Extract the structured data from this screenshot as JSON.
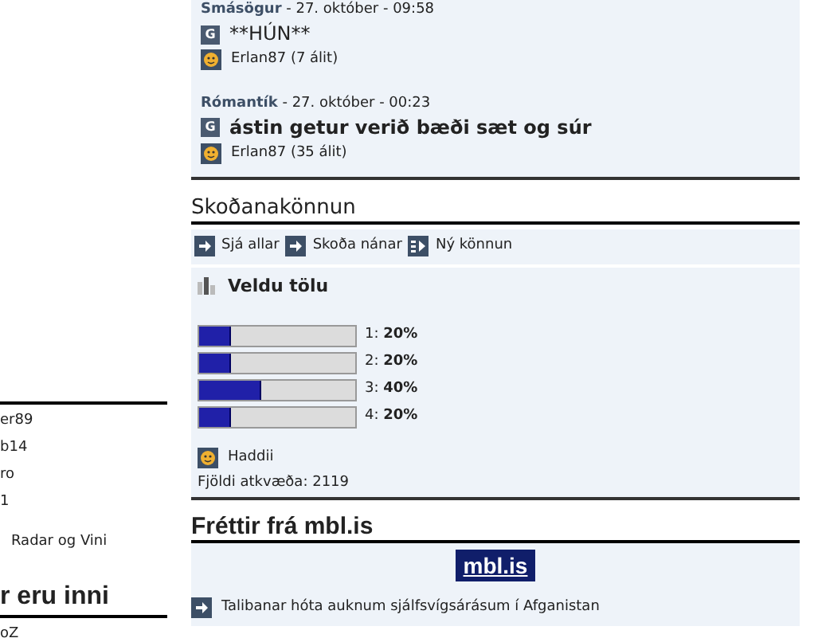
{
  "sidebar": {
    "users": [
      "er89",
      "b14",
      "ro",
      "1"
    ],
    "note": "Radar og Vini",
    "online_heading": "r eru inni",
    "online": [
      "oZ"
    ]
  },
  "stories": [
    {
      "category": "Smásögur",
      "date": " - 27. október - 09:58",
      "badge": "G",
      "title": "**HÚN**",
      "bold": false,
      "author": "Erlan87",
      "comments": "(7 álit)"
    },
    {
      "category": "Rómantík",
      "date": " - 27. október - 00:23",
      "badge": "G",
      "title": "ástin getur verið bæði sæt og súr",
      "bold": true,
      "author": "Erlan87",
      "comments": "(35 álit)"
    }
  ],
  "poll": {
    "heading": "Skoðanakönnun",
    "links": [
      {
        "label": "Sjá allar",
        "kind": "arrow"
      },
      {
        "label": "Skoða nánar",
        "kind": "arrow"
      },
      {
        "label": "Ný könnun",
        "kind": "new"
      }
    ],
    "question": "Veldu tölu",
    "options": [
      {
        "label": "1:",
        "value": "20%",
        "level": 0.2
      },
      {
        "label": "2:",
        "value": "20%",
        "level": 0.2
      },
      {
        "label": "3:",
        "value": "40%",
        "level": 0.4
      },
      {
        "label": "4:",
        "value": "20%",
        "level": 0.2
      }
    ],
    "author": "Haddii",
    "votes": "Fjöldi atkvæða: 2119"
  },
  "news": {
    "heading": "Fréttir frá mbl.is",
    "logo": "mbl.is",
    "items": [
      "Talibanar hóta auknum sjálfsvígsárásum í Afganistan"
    ]
  }
}
